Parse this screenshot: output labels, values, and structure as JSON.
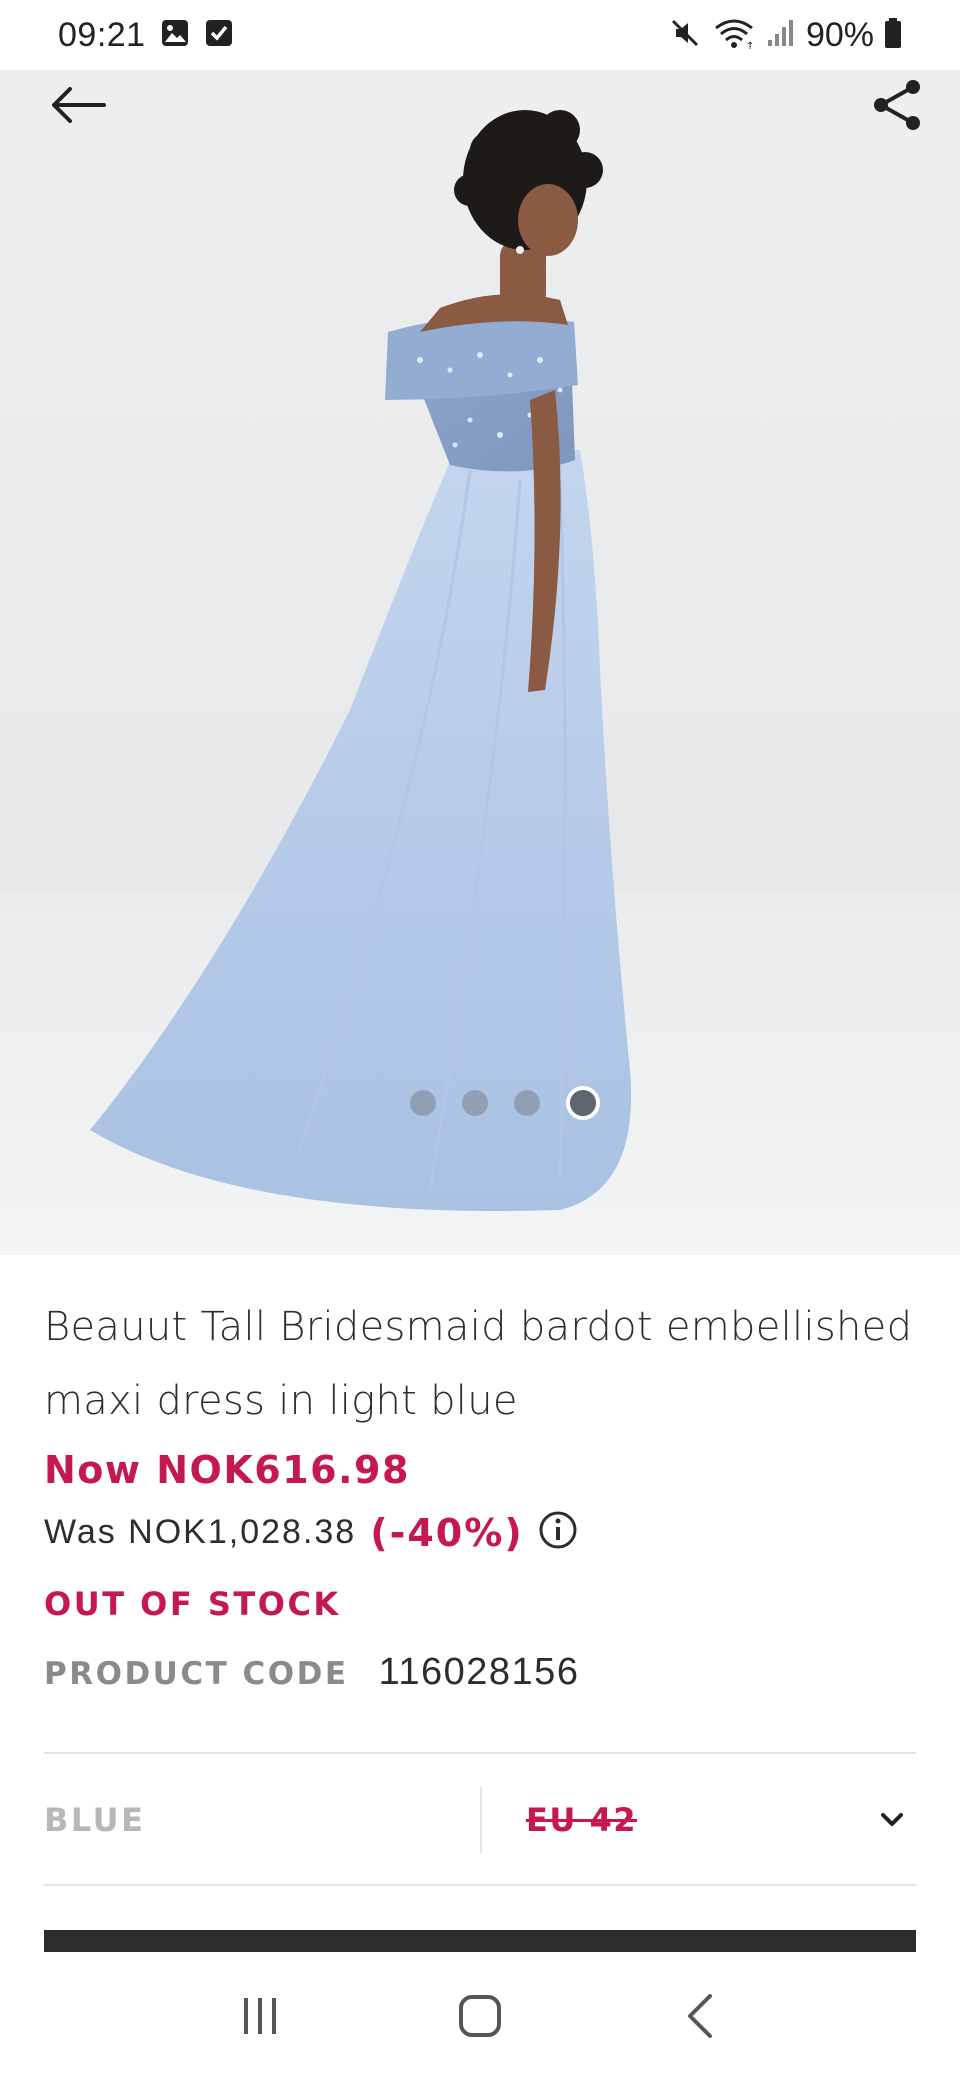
{
  "status_bar": {
    "time": "09:21",
    "battery": "90%",
    "icons": [
      "gallery-icon",
      "checkbox-icon",
      "mute-icon",
      "wifi-icon",
      "signal-icon",
      "battery-icon"
    ]
  },
  "toolbar": {
    "back_icon": "arrow-left-icon",
    "share_icon": "share-icon"
  },
  "carousel": {
    "total": 4,
    "active_index": 3
  },
  "product": {
    "title": "Beauut Tall Bridesmaid bardot embellished maxi dress in light blue",
    "price_now": "Now NOK616.98",
    "price_was": "Was NOK1,028.38",
    "discount": "(-40%)",
    "stock_status": "OUT OF STOCK",
    "code_label": "PRODUCT CODE",
    "code_value": "116028156"
  },
  "selectors": {
    "colour": "BLUE",
    "size": "EU 42"
  },
  "colors": {
    "accent_red": "#c4184f",
    "text_dark": "#2d2d2d",
    "muted_gray": "#8a8a8a",
    "dress_blue": "#b9cde8"
  }
}
